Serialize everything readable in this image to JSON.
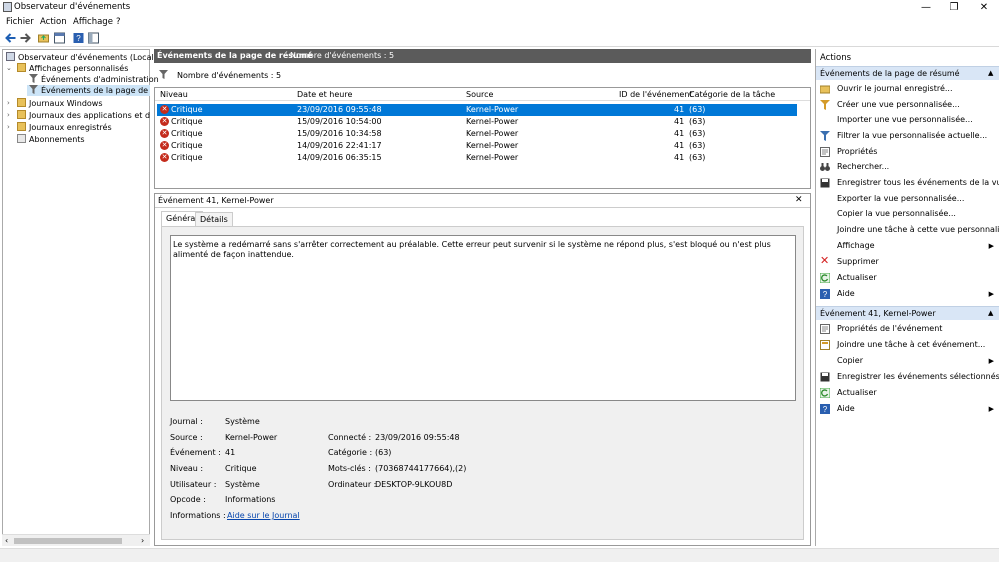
{
  "window": {
    "title": "Observateur d'événements",
    "controls": {
      "minimize": "—",
      "maximize": "❐",
      "close": "✕"
    }
  },
  "menu": [
    "Fichier",
    "Action",
    "Affichage",
    "?"
  ],
  "toolbar": [
    "back-arrow-icon",
    "forward-arrow-icon",
    "folder-up-icon",
    "properties-icon",
    "help-icon",
    "panel-icon"
  ],
  "tree": {
    "root": "Observateur d'événements (Local)",
    "custom_views": "Affichages personnalisés",
    "admin_events": "Événements d'administration",
    "summary_events": "Événements de la page de résur",
    "windows_logs": "Journaux Windows",
    "app_logs": "Journaux des applications et des se",
    "saved_logs": "Journaux enregistrés",
    "subscriptions": "Abonnements"
  },
  "center": {
    "header_title": "Événements de la page de résumé",
    "header_count": "Nombre d'événements : 5",
    "summary_text": "Nombre d'événements : 5",
    "columns": [
      "Niveau",
      "Date et heure",
      "Source",
      "ID de l'événement",
      "Catégorie de la tâche"
    ],
    "rows": [
      {
        "level": "Critique",
        "date": "23/09/2016 09:55:48",
        "source": "Kernel-Power",
        "id": "41",
        "category": "(63)"
      },
      {
        "level": "Critique",
        "date": "15/09/2016 10:54:00",
        "source": "Kernel-Power",
        "id": "41",
        "category": "(63)"
      },
      {
        "level": "Critique",
        "date": "15/09/2016 10:34:58",
        "source": "Kernel-Power",
        "id": "41",
        "category": "(63)"
      },
      {
        "level": "Critique",
        "date": "14/09/2016 22:41:17",
        "source": "Kernel-Power",
        "id": "41",
        "category": "(63)"
      },
      {
        "level": "Critique",
        "date": "14/09/2016 06:35:15",
        "source": "Kernel-Power",
        "id": "41",
        "category": "(63)"
      }
    ]
  },
  "detail": {
    "title": "Événement 41, Kernel-Power",
    "close": "✕",
    "tabs": [
      "Général",
      "Détails"
    ],
    "message": "Le système a redémarré sans s'arrêter correctement au préalable. Cette erreur peut survenir si le système ne répond plus, s'est bloqué ou n'est plus alimenté de façon inattendue.",
    "labels": {
      "journal": "Journal :",
      "source": "Source :",
      "event": "Événement :",
      "level": "Niveau :",
      "user": "Utilisateur :",
      "opcode": "Opcode :",
      "info": "Informations :",
      "logged": "Connecté :",
      "category": "Catégorie :",
      "keywords": "Mots-clés :",
      "computer": "Ordinateur :"
    },
    "values": {
      "journal": "Système",
      "source": "Kernel-Power",
      "event": "41",
      "level": "Critique",
      "user": "Système",
      "opcode": "Informations",
      "info_link": "Aide sur le Journal",
      "logged": "23/09/2016 09:55:48",
      "category": "(63)",
      "keywords": "(70368744177664),(2)",
      "computer": "DESKTOP-9LKOU8D"
    }
  },
  "actions": {
    "title": "Actions",
    "section1": "Événements de la page de résumé",
    "section1_items": [
      "Ouvrir le journal enregistré...",
      "Créer une vue personnalisée...",
      "Importer une vue personnalisée...",
      "Filtrer la vue personnalisée actuelle...",
      "Propriétés",
      "Rechercher...",
      "Enregistrer tous les événements de la vue...",
      "Exporter la vue personnalisée...",
      "Copier la vue personnalisée...",
      "Joindre une tâche à cette vue personnalis...",
      "Affichage",
      "Supprimer",
      "Actualiser",
      "Aide"
    ],
    "section2": "Événement 41, Kernel-Power",
    "section2_items": [
      "Propriétés de l'événement",
      "Joindre une tâche à cet événement...",
      "Copier",
      "Enregistrer les événements sélectionnés...",
      "Actualiser",
      "Aide"
    ]
  }
}
